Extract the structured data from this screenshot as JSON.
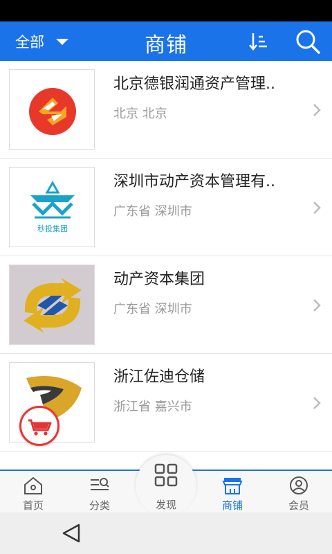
{
  "header": {
    "filter_label": "全部",
    "title": "商铺"
  },
  "stores": [
    {
      "name": "北京德银润通资产管理..",
      "location": "北京 北京",
      "logo": "red-orange-s-logo"
    },
    {
      "name": "深圳市动产资本管理有..",
      "location": "广东省 深圳市",
      "logo": "miaotou-group-logo",
      "logo_text": "秒投集团"
    },
    {
      "name": "动产资本集团",
      "location": "广东省 深圳市",
      "logo": "gold-blue-arrows-logo"
    },
    {
      "name": "浙江佐迪仓储",
      "location": "浙江省 嘉兴市",
      "logo": "gold-z-logo"
    }
  ],
  "tabs": [
    {
      "label": "首页",
      "icon": "home-icon"
    },
    {
      "label": "分类",
      "icon": "category-icon"
    },
    {
      "label": "发现",
      "icon": "grid-icon"
    },
    {
      "label": "商铺",
      "icon": "store-icon",
      "active": true
    },
    {
      "label": "会员",
      "icon": "user-icon"
    }
  ],
  "colors": {
    "brand": "#1a73e8",
    "cart_accent": "#e33333"
  }
}
